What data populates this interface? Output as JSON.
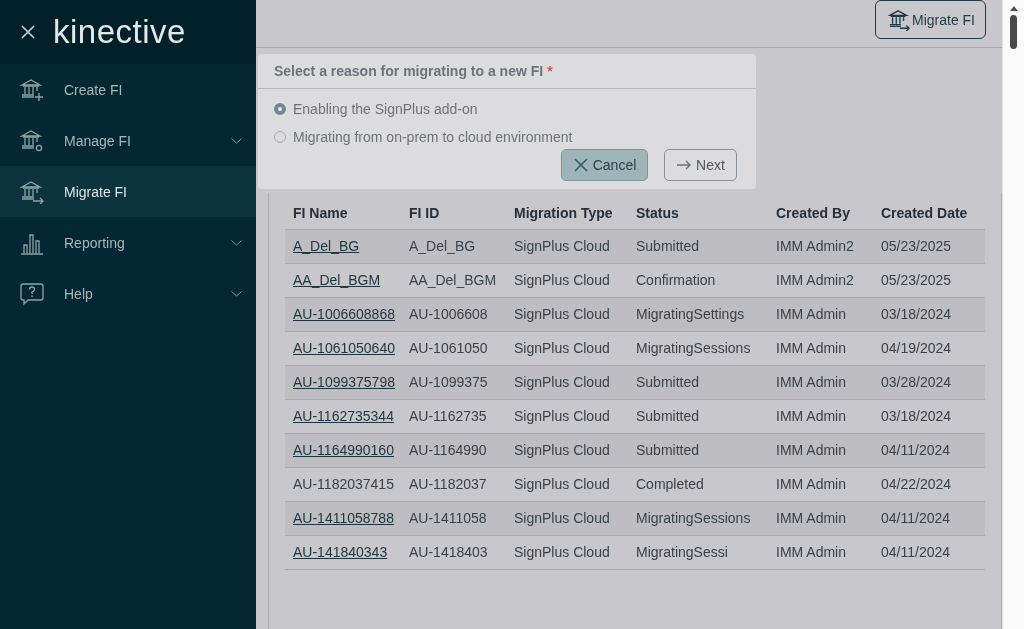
{
  "sidebar": {
    "brand": "kinective",
    "items": [
      {
        "kind": "create",
        "label": "Create FI",
        "has_submenu": false,
        "selected": false
      },
      {
        "kind": "manage",
        "label": "Manage FI",
        "has_submenu": true,
        "selected": false
      },
      {
        "kind": "migrate",
        "label": "Migrate FI",
        "has_submenu": false,
        "selected": true
      },
      {
        "kind": "reporting",
        "label": "Reporting",
        "has_submenu": true,
        "selected": false
      },
      {
        "kind": "help",
        "label": "Help",
        "has_submenu": true,
        "selected": false
      }
    ]
  },
  "toolbar": {
    "migrate_button": "Migrate FI"
  },
  "table": {
    "columns": [
      "FI Name",
      "FI ID",
      "Migration Type",
      "Status",
      "Created By",
      "Created Date"
    ],
    "rows": [
      {
        "linked": true,
        "cells": [
          "A_Del_BG",
          "A_Del_BG",
          "SignPlus Cloud",
          "Submitted",
          "IMM Admin2",
          "05/23/2025"
        ]
      },
      {
        "linked": true,
        "cells": [
          "AA_Del_BGM",
          "AA_Del_BGM",
          "SignPlus Cloud",
          "Confirmation",
          "IMM Admin2",
          "05/23/2025"
        ]
      },
      {
        "linked": true,
        "cells": [
          "AU-1006608868",
          "AU-1006608",
          "SignPlus Cloud",
          "MigratingSettings",
          "IMM Admin",
          "03/18/2024"
        ]
      },
      {
        "linked": true,
        "cells": [
          "AU-1061050640",
          "AU-1061050",
          "SignPlus Cloud",
          "MigratingSessions",
          "IMM Admin",
          "04/19/2024"
        ]
      },
      {
        "linked": true,
        "cells": [
          "AU-1099375798",
          "AU-1099375",
          "SignPlus Cloud",
          "Submitted",
          "IMM Admin",
          "03/28/2024"
        ]
      },
      {
        "linked": true,
        "cells": [
          "AU-1162735344",
          "AU-1162735",
          "SignPlus Cloud",
          "Submitted",
          "IMM Admin",
          "03/18/2024"
        ]
      },
      {
        "linked": true,
        "cells": [
          "AU-1164990160",
          "AU-1164990",
          "SignPlus Cloud",
          "Submitted",
          "IMM Admin",
          "04/11/2024"
        ]
      },
      {
        "linked": false,
        "cells": [
          "AU-1182037415",
          "AU-1182037",
          "SignPlus Cloud",
          "Completed",
          "IMM Admin",
          "04/22/2024"
        ]
      },
      {
        "linked": true,
        "cells": [
          "AU-1411058788",
          "AU-1411058",
          "SignPlus Cloud",
          "MigratingSessions",
          "IMM Admin",
          "04/11/2024"
        ]
      },
      {
        "linked": true,
        "cells": [
          "AU-141840343",
          "AU-1418403",
          "SignPlus Cloud",
          "MigratingSessi",
          "IMM Admin",
          "04/11/2024"
        ]
      }
    ]
  },
  "dialog": {
    "title": "Select a reason for migrating to a new FI",
    "required_mark": "*",
    "options": [
      {
        "label": "Enabling the SignPlus add-on",
        "selected": true
      },
      {
        "label": "Migrating from on-prem to cloud environment",
        "selected": false
      }
    ],
    "cancel": "Cancel",
    "next": "Next"
  }
}
